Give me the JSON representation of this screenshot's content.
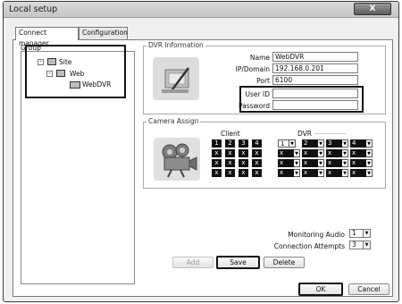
{
  "window": {
    "title": "Local setup",
    "close_glyph": "X"
  },
  "tabs": [
    {
      "label": "Connect manager"
    },
    {
      "label": "Configuration"
    }
  ],
  "group": {
    "label": "Group",
    "tree": [
      {
        "label": "Site",
        "toggle": "-"
      },
      {
        "label": "Web",
        "toggle": "-"
      },
      {
        "label": "WebDVR"
      }
    ]
  },
  "dvr_info": {
    "label": "DVR Information",
    "name_label": "Name",
    "name_value": "WebDVR",
    "ip_label": "IP/Domain",
    "ip_value": "192.168.0.201",
    "port_label": "Port",
    "port_value": "6100",
    "userid_label": "User ID",
    "userid_value": "",
    "password_label": "Password",
    "password_value": ""
  },
  "camera_assign": {
    "label": "Camera Assign",
    "client_label": "Client",
    "dvr_label": "DVR",
    "client_grid": [
      [
        "1",
        "2",
        "3",
        "4"
      ],
      [
        "x",
        "x",
        "x",
        "x"
      ],
      [
        "x",
        "x",
        "x",
        "x"
      ],
      [
        "x",
        "x",
        "x",
        "x"
      ]
    ],
    "dvr_grid": [
      [
        "1",
        "2",
        "3",
        "4"
      ],
      [
        "x",
        "x",
        "x",
        "x"
      ],
      [
        "x",
        "x",
        "x",
        "x"
      ],
      [
        "x",
        "x",
        "x",
        "x"
      ]
    ],
    "arrow_glyph": "▼"
  },
  "monitoring_audio": {
    "label": "Monitoring Audio",
    "value": "1"
  },
  "connection_attempts": {
    "label": "Connection Attempts",
    "value": "3"
  },
  "buttons": {
    "add": "Add",
    "save": "Save",
    "delete": "Delete",
    "ok": "OK",
    "cancel": "Cancel"
  }
}
